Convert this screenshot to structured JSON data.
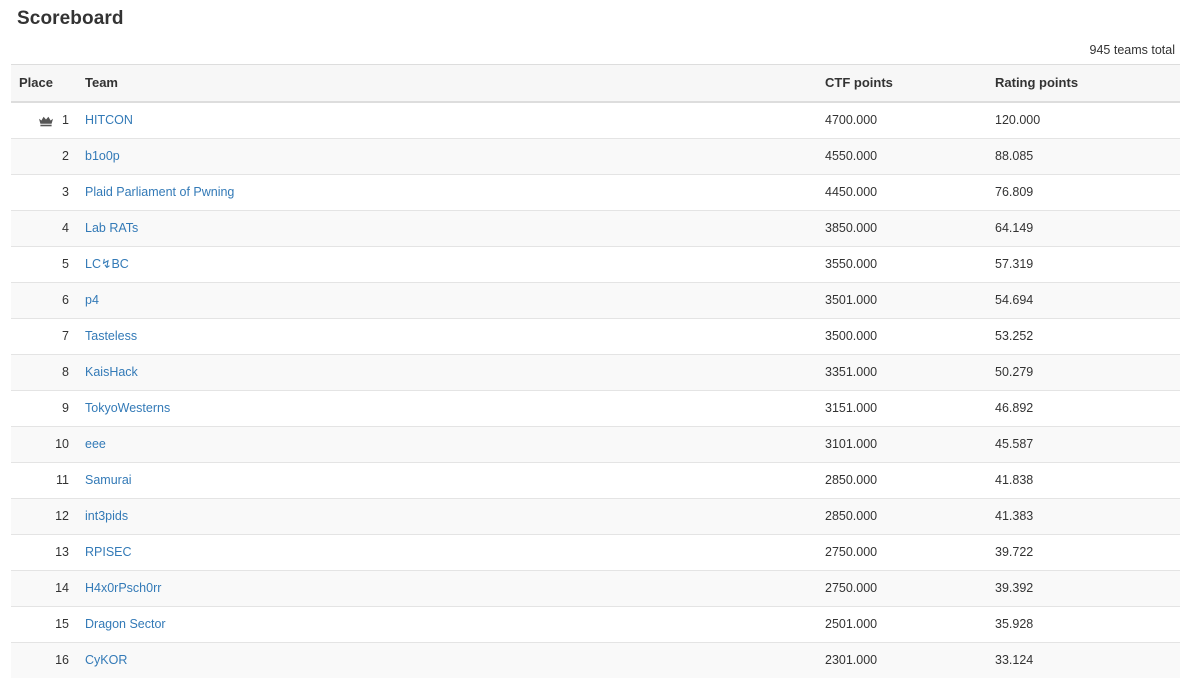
{
  "header": {
    "title": "Scoreboard",
    "teams_total": "945 teams total"
  },
  "table": {
    "columns": {
      "place": "Place",
      "team": "Team",
      "ctf_points": "CTF points",
      "rating_points": "Rating points"
    },
    "leader_icon": "crown-icon",
    "link_color": "#337ab7",
    "rows": [
      {
        "place": "1",
        "crown": true,
        "team": "HITCON",
        "ctf_points": "4700.000",
        "rating_points": "120.000"
      },
      {
        "place": "2",
        "crown": false,
        "team": "b1o0p",
        "ctf_points": "4550.000",
        "rating_points": "88.085"
      },
      {
        "place": "3",
        "crown": false,
        "team": "Plaid Parliament of Pwning",
        "ctf_points": "4450.000",
        "rating_points": "76.809"
      },
      {
        "place": "4",
        "crown": false,
        "team": "Lab RATs",
        "ctf_points": "3850.000",
        "rating_points": "64.149"
      },
      {
        "place": "5",
        "crown": false,
        "team": "LC↯BC",
        "ctf_points": "3550.000",
        "rating_points": "57.319"
      },
      {
        "place": "6",
        "crown": false,
        "team": "p4",
        "ctf_points": "3501.000",
        "rating_points": "54.694"
      },
      {
        "place": "7",
        "crown": false,
        "team": "Tasteless",
        "ctf_points": "3500.000",
        "rating_points": "53.252"
      },
      {
        "place": "8",
        "crown": false,
        "team": "KaisHack",
        "ctf_points": "3351.000",
        "rating_points": "50.279"
      },
      {
        "place": "9",
        "crown": false,
        "team": "TokyoWesterns",
        "ctf_points": "3151.000",
        "rating_points": "46.892"
      },
      {
        "place": "10",
        "crown": false,
        "team": "eee",
        "ctf_points": "3101.000",
        "rating_points": "45.587"
      },
      {
        "place": "11",
        "crown": false,
        "team": "Samurai",
        "ctf_points": "2850.000",
        "rating_points": "41.838"
      },
      {
        "place": "12",
        "crown": false,
        "team": "int3pids",
        "ctf_points": "2850.000",
        "rating_points": "41.383"
      },
      {
        "place": "13",
        "crown": false,
        "team": "RPISEC",
        "ctf_points": "2750.000",
        "rating_points": "39.722"
      },
      {
        "place": "14",
        "crown": false,
        "team": "H4x0rPsch0rr",
        "ctf_points": "2750.000",
        "rating_points": "39.392"
      },
      {
        "place": "15",
        "crown": false,
        "team": "Dragon Sector",
        "ctf_points": "2501.000",
        "rating_points": "35.928"
      },
      {
        "place": "16",
        "crown": false,
        "team": "CyKOR",
        "ctf_points": "2301.000",
        "rating_points": "33.124"
      }
    ]
  }
}
